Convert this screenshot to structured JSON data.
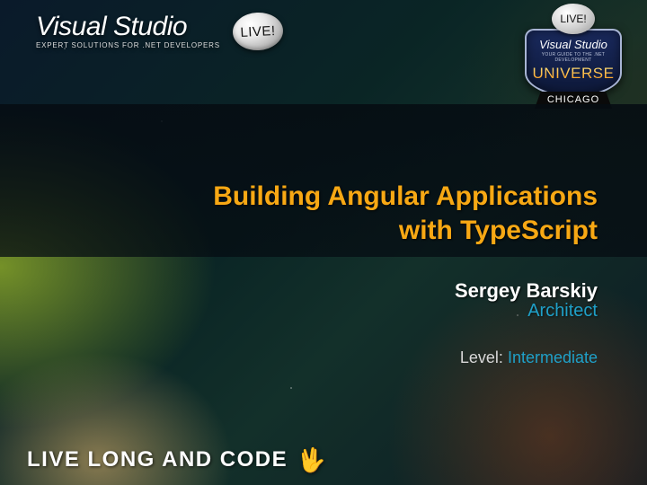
{
  "header": {
    "product": "Visual Studio",
    "tagline": "EXPERT SOLUTIONS FOR .NET DEVELOPERS",
    "badge": "LIVE!"
  },
  "crest": {
    "badge": "LIVE!",
    "product": "Visual Studio",
    "tagline": "YOUR GUIDE TO THE .NET DEVELOPMENT",
    "universe": "UNIVERSE",
    "city": "CHICAGO"
  },
  "talk": {
    "title_line1": "Building Angular Applications",
    "title_line2": "with TypeScript",
    "author": "Sergey Barskiy",
    "role": "Architect",
    "level_label": "Level:",
    "level_value": "Intermediate"
  },
  "footer": {
    "text": "LIVE LONG AND CODE",
    "icon": "vulcan-salute"
  }
}
